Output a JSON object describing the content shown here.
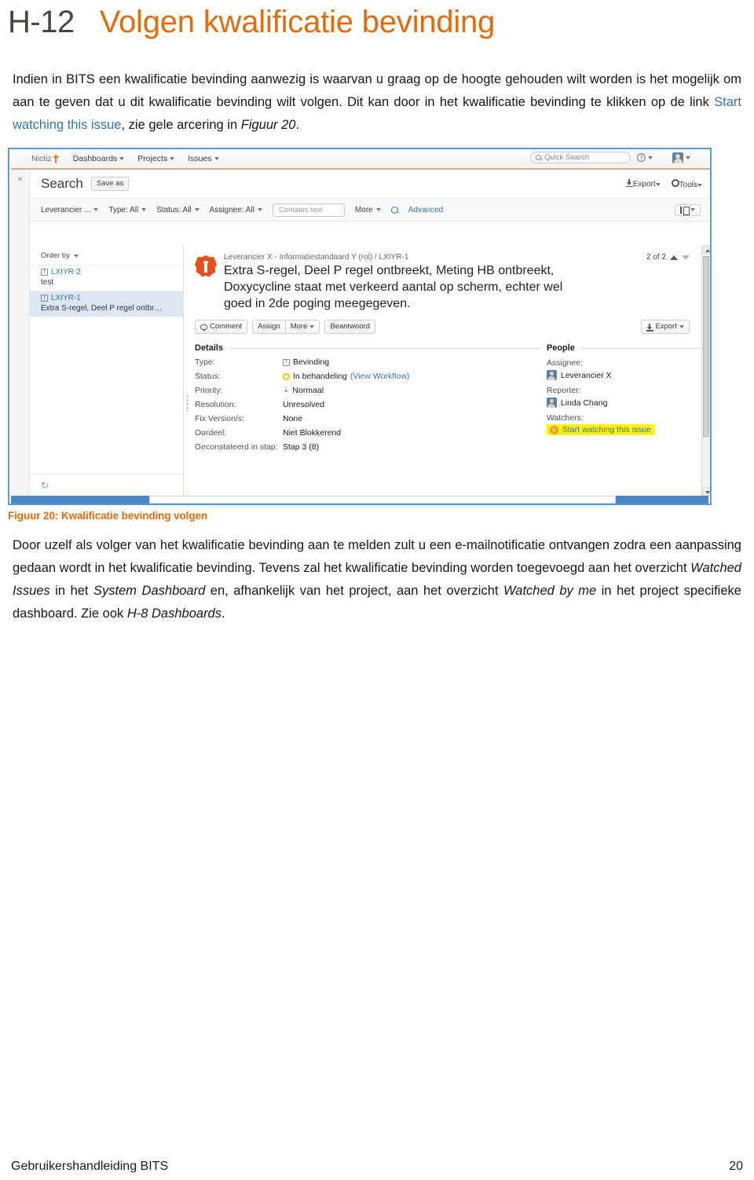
{
  "heading": {
    "number": "H-12",
    "title": "Volgen kwalificatie bevinding"
  },
  "intro": {
    "part1": "Indien in BITS een kwalificatie bevinding aanwezig is waarvan u graag op de hoogte gehouden wilt worden is het mogelijk om aan te geven dat u dit kwalificatie bevinding wilt volgen. Dit kan door in het kwalificatie bevinding te klikken op de link ",
    "link": "Start watching this issue",
    "part2": ", zie gele arcering in ",
    "figref": "Figuur 20",
    "part3": "."
  },
  "screenshot": {
    "nav": {
      "brand": "Nictiz",
      "items": [
        "Dashboards",
        "Projects",
        "Issues"
      ],
      "quick_search_placeholder": "Quick Search",
      "help_icon": "?",
      "avatar": "user-avatar"
    },
    "header": {
      "title": "Search",
      "save_as": "Save as",
      "export": "Export",
      "tools": "Tools"
    },
    "filters": {
      "project": "Leverancier ...",
      "type": "Type: All",
      "status": "Status: All",
      "assignee": "Assignee: All",
      "contains_placeholder": "Contains text",
      "more": "More",
      "advanced": "Advanced",
      "columns": "columns-icon"
    },
    "list": {
      "order_by": "Order by",
      "items": [
        {
          "key": "LXIYR-2",
          "summary": "test",
          "selected": false
        },
        {
          "key": "LXIYR-1",
          "summary": "Extra S-regel, Deel P regel ontbr…",
          "selected": true
        }
      ],
      "refresh": "refresh-icon"
    },
    "issue": {
      "breadcrumb_project": "Leverancier X - Informatiestandaard Y (rol)",
      "breadcrumb_sep": "/",
      "breadcrumb_key": "LXIYR-1",
      "summary": "Extra S-regel, Deel P regel ontbreekt, Meting HB ontbreekt, Doxycycline staat met verkeerd aantal op scherm, echter wel goed in 2de poging meegegeven.",
      "pager": "2 of 2",
      "actions": [
        "Comment",
        "Assign",
        "More",
        "Beantwoord"
      ],
      "export": "Export",
      "details_heading": "Details",
      "details": [
        {
          "label": "Type:",
          "value": "Bevinding",
          "icon": "issue-type-icon"
        },
        {
          "label": "Status:",
          "value": "In behandeling",
          "extra": "(View Workflow)",
          "icon": "status-icon"
        },
        {
          "label": "Priority:",
          "value": "Normaal",
          "icon": "priority-icon"
        },
        {
          "label": "Resolution:",
          "value": "Unresolved"
        },
        {
          "label": "Fix Version/s:",
          "value": "None"
        },
        {
          "label": "Oordeel:",
          "value": "Niet Blokkerend"
        },
        {
          "label": "Geconstateerd in stap:",
          "value": "Stap 3 (8)"
        }
      ],
      "people_heading": "People",
      "people": [
        {
          "label": "Assignee:",
          "value": "Leverancier X"
        },
        {
          "label": "Reporter:",
          "value": "Linda Chang"
        }
      ],
      "watchers_label": "Watchers:",
      "watchers_count": "0",
      "watch_link": "Start watching this issue",
      "highlight_color": "#FFF500"
    }
  },
  "caption": "Figuur 20: Kwalificatie bevinding volgen",
  "body": {
    "p1": "Door uzelf als volger van het kwalificatie bevinding aan te melden zult u een e-mailnotificatie ontvangen zodra een aanpassing gedaan wordt in het kwalificatie bevinding. Tevens zal het kwalificatie bevinding worden toegevoegd aan het overzicht ",
    "i1": "Watched Issues",
    "p2": " in het ",
    "i2": "System Dashboard",
    "p3": " en, afhankelijk van het project, aan het overzicht ",
    "i3": "Watched by me",
    "p4": " in het project specifieke dashboard. Zie ook ",
    "i4": "H-8 Dashboards",
    "p5": "."
  },
  "footer": {
    "left": "Gebruikershandleiding BITS",
    "page": "20"
  }
}
